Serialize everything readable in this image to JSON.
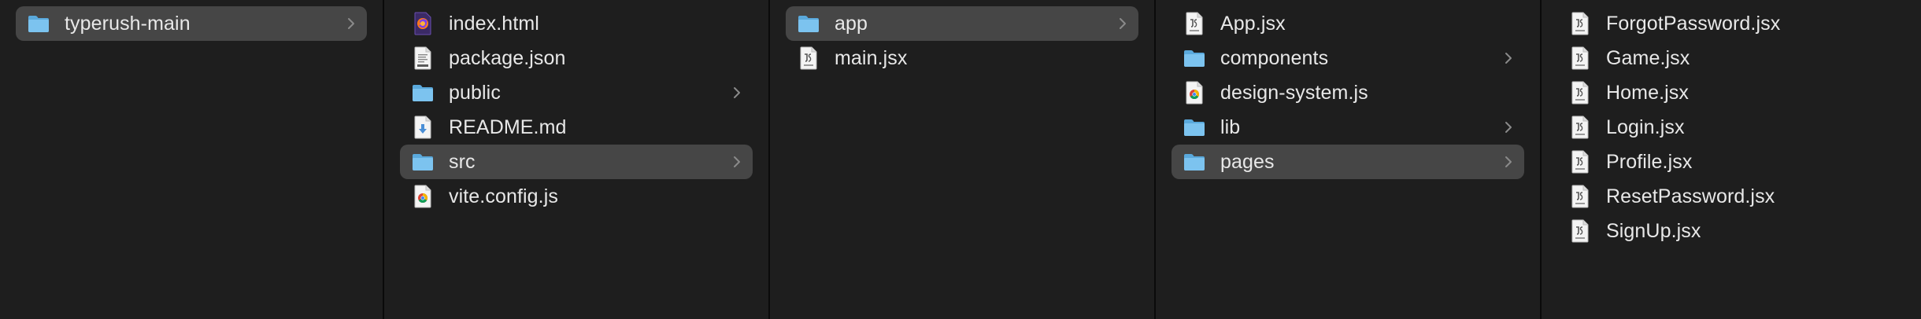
{
  "columns": [
    {
      "items": [
        {
          "label": "typerush-main",
          "icon": "folder-icon",
          "folder": true,
          "selected": true
        }
      ]
    },
    {
      "items": [
        {
          "label": "index.html",
          "icon": "html-file-icon",
          "folder": false,
          "selected": false
        },
        {
          "label": "package.json",
          "icon": "json-file-icon",
          "folder": false,
          "selected": false
        },
        {
          "label": "public",
          "icon": "folder-icon",
          "folder": true,
          "selected": false
        },
        {
          "label": "README.md",
          "icon": "markdown-file-icon",
          "folder": false,
          "selected": false
        },
        {
          "label": "src",
          "icon": "folder-icon",
          "folder": true,
          "selected": true
        },
        {
          "label": "vite.config.js",
          "icon": "js-file-icon",
          "folder": false,
          "selected": false
        }
      ]
    },
    {
      "items": [
        {
          "label": "app",
          "icon": "folder-icon",
          "folder": true,
          "selected": true
        },
        {
          "label": "main.jsx",
          "icon": "jsx-file-icon",
          "folder": false,
          "selected": false
        }
      ]
    },
    {
      "items": [
        {
          "label": "App.jsx",
          "icon": "jsx-file-icon",
          "folder": false,
          "selected": false
        },
        {
          "label": "components",
          "icon": "folder-icon",
          "folder": true,
          "selected": false
        },
        {
          "label": "design-system.js",
          "icon": "js-file-icon",
          "folder": false,
          "selected": false
        },
        {
          "label": "lib",
          "icon": "folder-icon",
          "folder": true,
          "selected": false
        },
        {
          "label": "pages",
          "icon": "folder-icon",
          "folder": true,
          "selected": true
        }
      ]
    },
    {
      "items": [
        {
          "label": "ForgotPassword.jsx",
          "icon": "jsx-file-icon",
          "folder": false,
          "selected": false
        },
        {
          "label": "Game.jsx",
          "icon": "jsx-file-icon",
          "folder": false,
          "selected": false
        },
        {
          "label": "Home.jsx",
          "icon": "jsx-file-icon",
          "folder": false,
          "selected": false
        },
        {
          "label": "Login.jsx",
          "icon": "jsx-file-icon",
          "folder": false,
          "selected": false
        },
        {
          "label": "Profile.jsx",
          "icon": "jsx-file-icon",
          "folder": false,
          "selected": false
        },
        {
          "label": "ResetPassword.jsx",
          "icon": "jsx-file-icon",
          "folder": false,
          "selected": false
        },
        {
          "label": "SignUp.jsx",
          "icon": "jsx-file-icon",
          "folder": false,
          "selected": false
        }
      ]
    }
  ],
  "colors": {
    "background": "#1e1e1e",
    "selection": "#464646",
    "divider": "#0a0a0a",
    "folder": "#7cc3ef",
    "text": "#e8e8e8",
    "chevron": "#8a8a8a"
  }
}
